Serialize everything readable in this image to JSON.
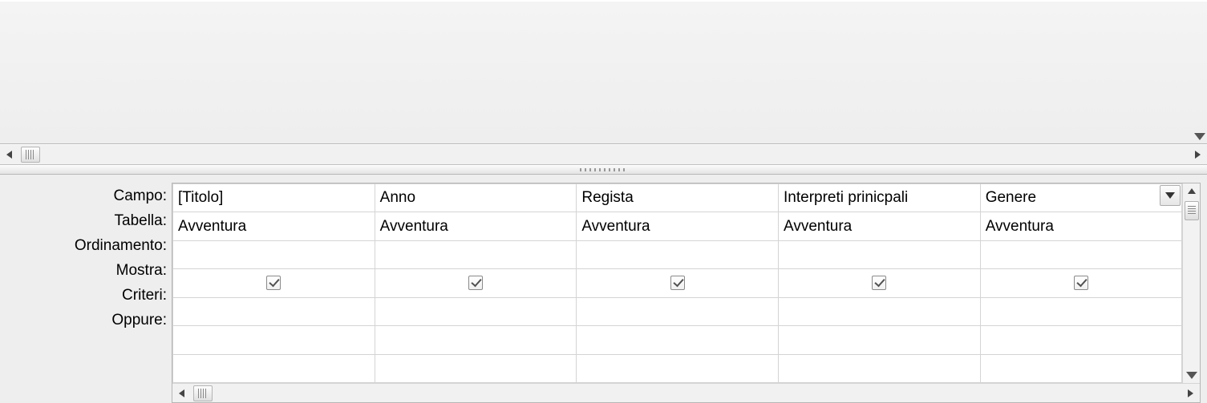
{
  "row_labels": {
    "campo": "Campo:",
    "tabella": "Tabella:",
    "ordinamento": "Ordinamento:",
    "mostra": "Mostra:",
    "criteri": "Criteri:",
    "oppure": "Oppure:"
  },
  "columns": [
    {
      "campo": "[Titolo]",
      "tabella": "Avventura",
      "ordinamento": "",
      "mostra": true,
      "criteri": "",
      "oppure": ""
    },
    {
      "campo": "Anno",
      "tabella": "Avventura",
      "ordinamento": "",
      "mostra": true,
      "criteri": "",
      "oppure": ""
    },
    {
      "campo": "Regista",
      "tabella": "Avventura",
      "ordinamento": "",
      "mostra": true,
      "criteri": "",
      "oppure": ""
    },
    {
      "campo": "Interpreti prinicpali",
      "tabella": "Avventura",
      "ordinamento": "",
      "mostra": true,
      "criteri": "",
      "oppure": ""
    },
    {
      "campo": "Genere",
      "tabella": "Avventura",
      "ordinamento": "",
      "mostra": true,
      "criteri": "",
      "oppure": ""
    }
  ]
}
